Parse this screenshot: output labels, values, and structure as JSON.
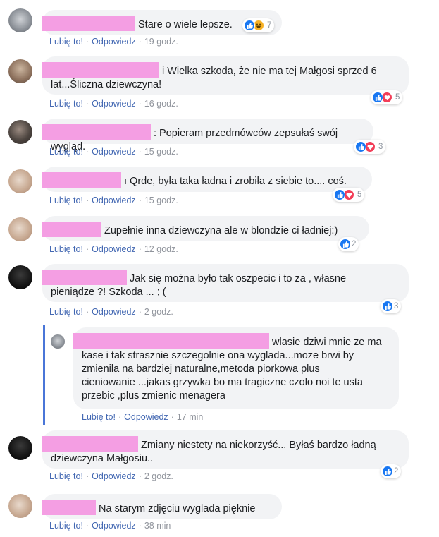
{
  "labels": {
    "like": "Lubię to!",
    "reply": "Odpowiedz",
    "sep": "·"
  },
  "icons": {
    "like": "like-icon",
    "love": "love-icon",
    "haha": "haha-icon"
  },
  "colors": {
    "link": "#4267b2",
    "bubble": "#f2f3f5",
    "redaction": "#f49ee3",
    "like": "#1877f2",
    "love": "#f33e58",
    "haha": "#f7b125",
    "thread": "#4a76d8"
  },
  "comments": [
    {
      "text": "Stare o wiele lepsze.",
      "time": "19 godz.",
      "reactions": [
        "like",
        "haha"
      ],
      "count": "7"
    },
    {
      "text": "i Wielka szkoda, że nie ma tej Małgosi sprzed 6\nlat...Śliczna dziewczyna!",
      "time": "16 godz.",
      "reactions": [
        "like",
        "love"
      ],
      "count": "5"
    },
    {
      "text": ": Popieram przedmówców zepsułaś swój wygląd.",
      "time": "15 godz.",
      "reactions": [
        "like",
        "love"
      ],
      "count": "3"
    },
    {
      "text": "ı Qrde, była taka ładna i zrobiła z siebie to.... coś.",
      "time": "15 godz.",
      "reactions": [
        "like",
        "love"
      ],
      "count": "5"
    },
    {
      "text": "Zupełnie inna dziewczyna ale w blondzie ci ładniej:)",
      "time": "12 godz.",
      "reactions": [
        "like"
      ],
      "count": "2"
    },
    {
      "text": "Jak się można było tak oszpecic i to za , własne\npieniądze ?! Szkoda ... ; (",
      "time": "2 godz.",
      "reactions": [
        "like"
      ],
      "count": "3"
    },
    {
      "text": "wlasie dziwi mnie ze ma\nkase i tak strasznie szczegolnie ona wyglada...moze brwi by\nzmienila na bardziej naturalne,metoda piorkowa plus\ncieniowanie ...jakas grzywka bo ma tragiczne czolo noi te usta\nprzebic ,plus zmienic menagera",
      "time": "17 min",
      "reactions": [],
      "count": ""
    },
    {
      "text": "Zmiany niestety na niekorzyść... Byłaś bardzo ładną\ndziewczyna Małgosiu..",
      "time": "2 godz.",
      "reactions": [
        "like"
      ],
      "count": "2"
    },
    {
      "text": "Na starym zdjęciu wyglada pięknie",
      "time": "38 min",
      "reactions": [],
      "count": ""
    }
  ]
}
